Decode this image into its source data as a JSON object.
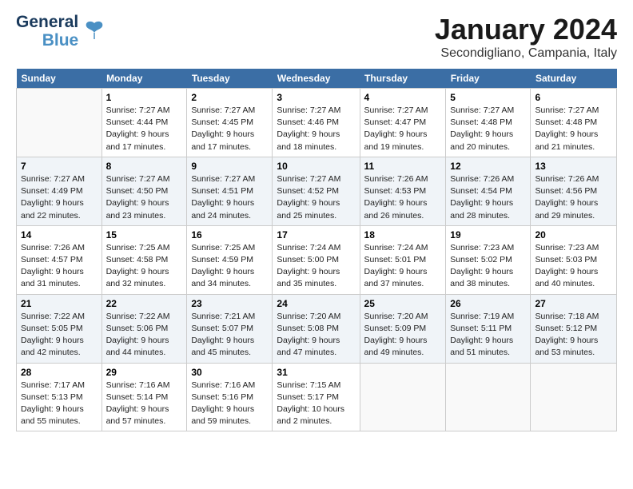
{
  "header": {
    "logo_line1": "General",
    "logo_line2": "Blue",
    "title": "January 2024",
    "subtitle": "Secondigliano, Campania, Italy"
  },
  "columns": [
    "Sunday",
    "Monday",
    "Tuesday",
    "Wednesday",
    "Thursday",
    "Friday",
    "Saturday"
  ],
  "weeks": [
    [
      {
        "day": "",
        "sunrise": "",
        "sunset": "",
        "daylight": ""
      },
      {
        "day": "1",
        "sunrise": "Sunrise: 7:27 AM",
        "sunset": "Sunset: 4:44 PM",
        "daylight": "Daylight: 9 hours and 17 minutes."
      },
      {
        "day": "2",
        "sunrise": "Sunrise: 7:27 AM",
        "sunset": "Sunset: 4:45 PM",
        "daylight": "Daylight: 9 hours and 17 minutes."
      },
      {
        "day": "3",
        "sunrise": "Sunrise: 7:27 AM",
        "sunset": "Sunset: 4:46 PM",
        "daylight": "Daylight: 9 hours and 18 minutes."
      },
      {
        "day": "4",
        "sunrise": "Sunrise: 7:27 AM",
        "sunset": "Sunset: 4:47 PM",
        "daylight": "Daylight: 9 hours and 19 minutes."
      },
      {
        "day": "5",
        "sunrise": "Sunrise: 7:27 AM",
        "sunset": "Sunset: 4:48 PM",
        "daylight": "Daylight: 9 hours and 20 minutes."
      },
      {
        "day": "6",
        "sunrise": "Sunrise: 7:27 AM",
        "sunset": "Sunset: 4:48 PM",
        "daylight": "Daylight: 9 hours and 21 minutes."
      }
    ],
    [
      {
        "day": "7",
        "sunrise": "Sunrise: 7:27 AM",
        "sunset": "Sunset: 4:49 PM",
        "daylight": "Daylight: 9 hours and 22 minutes."
      },
      {
        "day": "8",
        "sunrise": "Sunrise: 7:27 AM",
        "sunset": "Sunset: 4:50 PM",
        "daylight": "Daylight: 9 hours and 23 minutes."
      },
      {
        "day": "9",
        "sunrise": "Sunrise: 7:27 AM",
        "sunset": "Sunset: 4:51 PM",
        "daylight": "Daylight: 9 hours and 24 minutes."
      },
      {
        "day": "10",
        "sunrise": "Sunrise: 7:27 AM",
        "sunset": "Sunset: 4:52 PM",
        "daylight": "Daylight: 9 hours and 25 minutes."
      },
      {
        "day": "11",
        "sunrise": "Sunrise: 7:26 AM",
        "sunset": "Sunset: 4:53 PM",
        "daylight": "Daylight: 9 hours and 26 minutes."
      },
      {
        "day": "12",
        "sunrise": "Sunrise: 7:26 AM",
        "sunset": "Sunset: 4:54 PM",
        "daylight": "Daylight: 9 hours and 28 minutes."
      },
      {
        "day": "13",
        "sunrise": "Sunrise: 7:26 AM",
        "sunset": "Sunset: 4:56 PM",
        "daylight": "Daylight: 9 hours and 29 minutes."
      }
    ],
    [
      {
        "day": "14",
        "sunrise": "Sunrise: 7:26 AM",
        "sunset": "Sunset: 4:57 PM",
        "daylight": "Daylight: 9 hours and 31 minutes."
      },
      {
        "day": "15",
        "sunrise": "Sunrise: 7:25 AM",
        "sunset": "Sunset: 4:58 PM",
        "daylight": "Daylight: 9 hours and 32 minutes."
      },
      {
        "day": "16",
        "sunrise": "Sunrise: 7:25 AM",
        "sunset": "Sunset: 4:59 PM",
        "daylight": "Daylight: 9 hours and 34 minutes."
      },
      {
        "day": "17",
        "sunrise": "Sunrise: 7:24 AM",
        "sunset": "Sunset: 5:00 PM",
        "daylight": "Daylight: 9 hours and 35 minutes."
      },
      {
        "day": "18",
        "sunrise": "Sunrise: 7:24 AM",
        "sunset": "Sunset: 5:01 PM",
        "daylight": "Daylight: 9 hours and 37 minutes."
      },
      {
        "day": "19",
        "sunrise": "Sunrise: 7:23 AM",
        "sunset": "Sunset: 5:02 PM",
        "daylight": "Daylight: 9 hours and 38 minutes."
      },
      {
        "day": "20",
        "sunrise": "Sunrise: 7:23 AM",
        "sunset": "Sunset: 5:03 PM",
        "daylight": "Daylight: 9 hours and 40 minutes."
      }
    ],
    [
      {
        "day": "21",
        "sunrise": "Sunrise: 7:22 AM",
        "sunset": "Sunset: 5:05 PM",
        "daylight": "Daylight: 9 hours and 42 minutes."
      },
      {
        "day": "22",
        "sunrise": "Sunrise: 7:22 AM",
        "sunset": "Sunset: 5:06 PM",
        "daylight": "Daylight: 9 hours and 44 minutes."
      },
      {
        "day": "23",
        "sunrise": "Sunrise: 7:21 AM",
        "sunset": "Sunset: 5:07 PM",
        "daylight": "Daylight: 9 hours and 45 minutes."
      },
      {
        "day": "24",
        "sunrise": "Sunrise: 7:20 AM",
        "sunset": "Sunset: 5:08 PM",
        "daylight": "Daylight: 9 hours and 47 minutes."
      },
      {
        "day": "25",
        "sunrise": "Sunrise: 7:20 AM",
        "sunset": "Sunset: 5:09 PM",
        "daylight": "Daylight: 9 hours and 49 minutes."
      },
      {
        "day": "26",
        "sunrise": "Sunrise: 7:19 AM",
        "sunset": "Sunset: 5:11 PM",
        "daylight": "Daylight: 9 hours and 51 minutes."
      },
      {
        "day": "27",
        "sunrise": "Sunrise: 7:18 AM",
        "sunset": "Sunset: 5:12 PM",
        "daylight": "Daylight: 9 hours and 53 minutes."
      }
    ],
    [
      {
        "day": "28",
        "sunrise": "Sunrise: 7:17 AM",
        "sunset": "Sunset: 5:13 PM",
        "daylight": "Daylight: 9 hours and 55 minutes."
      },
      {
        "day": "29",
        "sunrise": "Sunrise: 7:16 AM",
        "sunset": "Sunset: 5:14 PM",
        "daylight": "Daylight: 9 hours and 57 minutes."
      },
      {
        "day": "30",
        "sunrise": "Sunrise: 7:16 AM",
        "sunset": "Sunset: 5:16 PM",
        "daylight": "Daylight: 9 hours and 59 minutes."
      },
      {
        "day": "31",
        "sunrise": "Sunrise: 7:15 AM",
        "sunset": "Sunset: 5:17 PM",
        "daylight": "Daylight: 10 hours and 2 minutes."
      },
      {
        "day": "",
        "sunrise": "",
        "sunset": "",
        "daylight": ""
      },
      {
        "day": "",
        "sunrise": "",
        "sunset": "",
        "daylight": ""
      },
      {
        "day": "",
        "sunrise": "",
        "sunset": "",
        "daylight": ""
      }
    ]
  ]
}
